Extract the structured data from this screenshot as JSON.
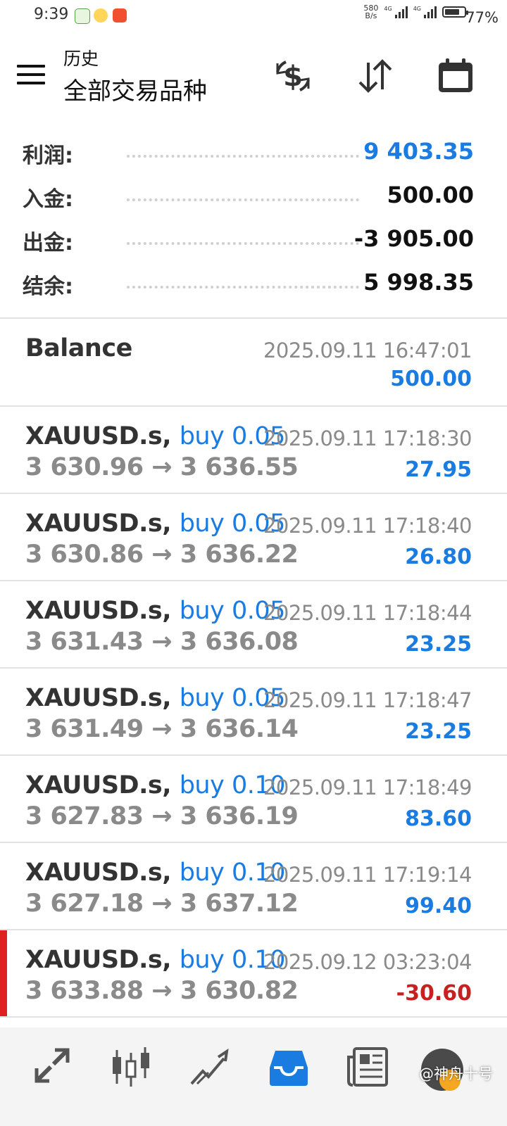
{
  "status_bar": {
    "time": "9:39",
    "net_speed_value": "580",
    "net_speed_unit": "B/s",
    "sim1_label": "4G",
    "sim2_label": "4G",
    "battery_percent": "77%",
    "battery_level": 0.77
  },
  "header": {
    "subtitle": "历史",
    "title": "全部交易品种",
    "icons": [
      "currency-exchange-icon",
      "sort-icon",
      "calendar-icon"
    ]
  },
  "summary": {
    "profit_label": "利润:",
    "profit_value": "9 403.35",
    "deposit_label": "入金:",
    "deposit_value": "500.00",
    "withdrawal_label": "出金:",
    "withdrawal_value": "-3 905.00",
    "balance_label": "结余:",
    "balance_value": "5 998.35"
  },
  "colors": {
    "accent_blue": "#1a7ce0",
    "loss_red": "#c62020",
    "marker_red": "#e02020",
    "muted_gray": "#8a8a8a"
  },
  "history": {
    "balance_entry": {
      "title": "Balance",
      "time": "2025.09.11 16:47:01",
      "amount": "500.00"
    },
    "trades": [
      {
        "symbol": "XAUUSD.s,",
        "side": "buy 0.05",
        "open_price": "3 630.96",
        "arrow": "→",
        "close_price": "3 636.55",
        "time": "2025.09.11 17:18:30",
        "profit": "27.95"
      },
      {
        "symbol": "XAUUSD.s,",
        "side": "buy 0.05",
        "open_price": "3 630.86",
        "arrow": "→",
        "close_price": "3 636.22",
        "time": "2025.09.11 17:18:40",
        "profit": "26.80"
      },
      {
        "symbol": "XAUUSD.s,",
        "side": "buy 0.05",
        "open_price": "3 631.43",
        "arrow": "→",
        "close_price": "3 636.08",
        "time": "2025.09.11 17:18:44",
        "profit": "23.25"
      },
      {
        "symbol": "XAUUSD.s,",
        "side": "buy 0.05",
        "open_price": "3 631.49",
        "arrow": "→",
        "close_price": "3 636.14",
        "time": "2025.09.11 17:18:47",
        "profit": "23.25"
      },
      {
        "symbol": "XAUUSD.s,",
        "side": "buy 0.10",
        "open_price": "3 627.83",
        "arrow": "→",
        "close_price": "3 636.19",
        "time": "2025.09.11 17:18:49",
        "profit": "83.60"
      },
      {
        "symbol": "XAUUSD.s,",
        "side": "buy 0.10",
        "open_price": "3 627.18",
        "arrow": "→",
        "close_price": "3 637.12",
        "time": "2025.09.11 17:19:14",
        "profit": "99.40"
      },
      {
        "symbol": "XAUUSD.s,",
        "side": "buy 0.10",
        "open_price": "3 633.88",
        "arrow": "→",
        "close_price": "3 630.82",
        "time": "2025.09.12 03:23:04",
        "profit": "-30.60"
      }
    ]
  },
  "bottom_nav": {
    "items": [
      "quotes-icon",
      "chart-candles-icon",
      "trade-icon",
      "history-icon",
      "news-icon"
    ],
    "active": "history-icon",
    "watermark": "@神舟十号"
  }
}
